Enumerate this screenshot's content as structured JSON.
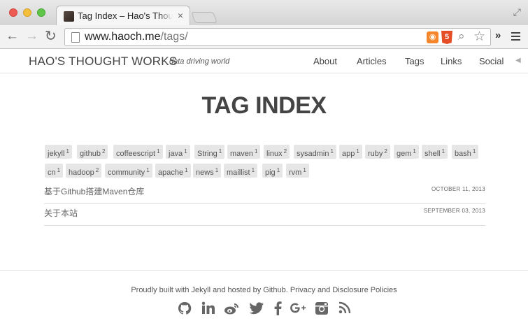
{
  "browser": {
    "tab_title": "Tag Index – Hao's Thought Works",
    "tab_close": "×",
    "url_host": "www.haoch.me",
    "url_path": "/tags/",
    "ext_rss": "◉",
    "ext_html5": "5"
  },
  "header": {
    "brand": "HAO'S THOUGHT WORKS",
    "tagline": "data driving world",
    "nav": {
      "about": "About",
      "articles": "Articles",
      "tags": "Tags",
      "links": "Links",
      "social": "Social"
    }
  },
  "main": {
    "title": "TAG INDEX",
    "tags": [
      {
        "name": "jekyll",
        "count": "1"
      },
      {
        "name": "github",
        "count": "2"
      },
      {
        "name": "coffeescript",
        "count": "1"
      },
      {
        "name": "java",
        "count": "1"
      },
      {
        "name": "String",
        "count": "1"
      },
      {
        "name": "maven",
        "count": "1"
      },
      {
        "name": "linux",
        "count": "2"
      },
      {
        "name": "sysadmin",
        "count": "1"
      },
      {
        "name": "app",
        "count": "1"
      },
      {
        "name": "ruby",
        "count": "2"
      },
      {
        "name": "gem",
        "count": "1"
      },
      {
        "name": "shell",
        "count": "1"
      },
      {
        "name": "bash",
        "count": "1"
      },
      {
        "name": "cn",
        "count": "1"
      },
      {
        "name": "hadoop",
        "count": "2"
      },
      {
        "name": "community",
        "count": "1"
      },
      {
        "name": "apache",
        "count": "1"
      },
      {
        "name": "news",
        "count": "1"
      },
      {
        "name": "maillist",
        "count": "1"
      },
      {
        "name": "pig",
        "count": "1"
      },
      {
        "name": "rvm",
        "count": "1"
      }
    ],
    "posts": [
      {
        "title": "基于Github搭建Maven仓库",
        "date": "OCTOBER 11, 2013"
      },
      {
        "title": "关于本站",
        "date": "SEPTEMBER 03, 2013"
      }
    ]
  },
  "footer": {
    "text_prefix": "Proudly built with ",
    "jekyll": "Jekyll",
    "text_mid": " and hosted by ",
    "github": "Github",
    "text_dot": ". ",
    "privacy": "Privacy and Disclosure Policies",
    "social": [
      "github",
      "linkedin",
      "weibo",
      "twitter",
      "facebook",
      "google-plus",
      "instagram",
      "rss"
    ]
  },
  "colors": {
    "accent_text": "#444444",
    "tag_bg": "#e6e6e6"
  }
}
